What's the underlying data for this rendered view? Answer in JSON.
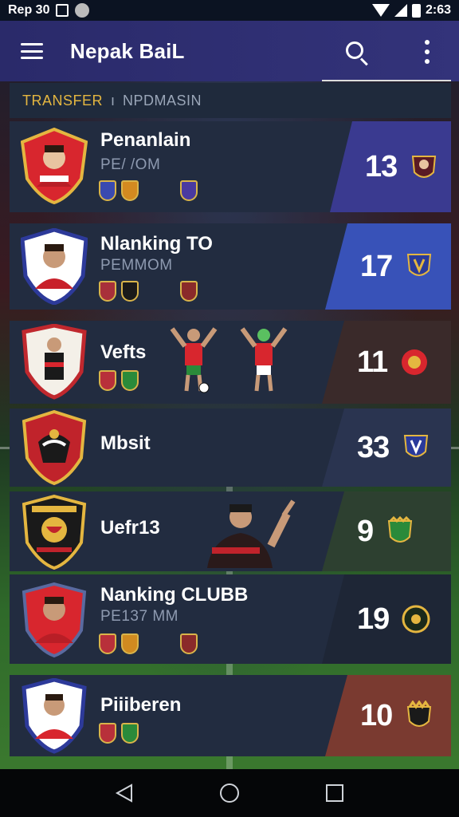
{
  "status_bar": {
    "left_text": "Rep 30",
    "time": "2:63"
  },
  "app_bar": {
    "title": "Nepak BaiL"
  },
  "filter": {
    "primary": "TRANSFER",
    "separator": "ı",
    "secondary": "NPDMASIN"
  },
  "cards": [
    {
      "name": "Penanlain",
      "sub": "PE/ /OM",
      "rank": "13",
      "panel_color": "#3a3a90",
      "crest_color": "#d8262e",
      "crest_border": "#e4b640"
    },
    {
      "name": "Nlanking TO",
      "sub": "PEMMOM",
      "rank": "17",
      "panel_color": "#3852b8",
      "crest_color": "#ffffff",
      "crest_border": "#2d3a9a"
    },
    {
      "name": "Vefts",
      "sub": "",
      "rank": "11",
      "panel_color": "#3a2a2a",
      "crest_color": "#f4f0e8",
      "crest_border": "#c0282e"
    },
    {
      "name": "Mbsit",
      "sub": "",
      "rank": "33",
      "panel_color": "#2a3450",
      "crest_color": "#c0232b",
      "crest_border": "#e4b640"
    },
    {
      "name": "Uefr13",
      "sub": "",
      "rank": "9",
      "panel_color": "#2d4030",
      "crest_color": "#1a1a1a",
      "crest_border": "#e4b640"
    },
    {
      "name": "Nanking CLUBB",
      "sub": "PE137 MM",
      "rank": "19",
      "panel_color": "#1e2636",
      "crest_color": "#d8262e",
      "crest_border": "#5a6aa0"
    },
    {
      "name": "Piiiberen",
      "sub": "",
      "rank": "10",
      "panel_color": "#7a3a30",
      "crest_color": "#ffffff",
      "crest_border": "#2d3a9a"
    }
  ],
  "icons": {
    "menu": "hamburger-icon",
    "search": "search-icon",
    "more": "more-vert-icon",
    "nav_back": "triangle-back-icon",
    "nav_home": "circle-home-icon",
    "nav_recents": "square-recents-icon"
  }
}
